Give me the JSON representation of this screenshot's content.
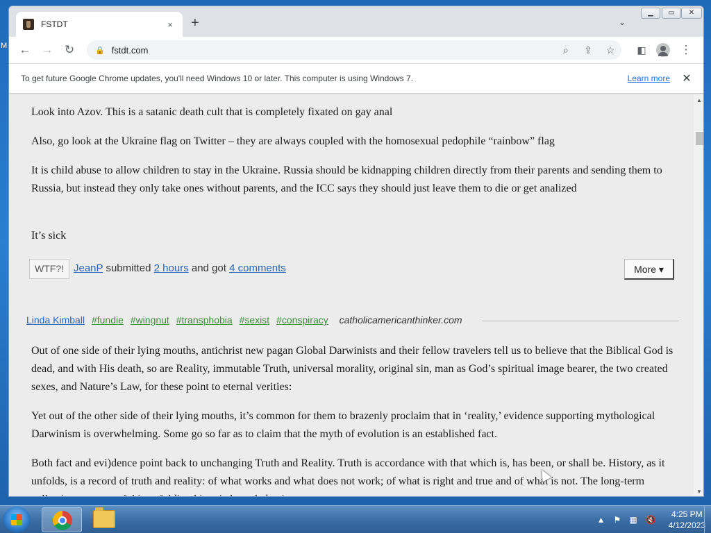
{
  "desktop": {
    "edge_letter": "M"
  },
  "browser": {
    "tab_title": "FSTDT",
    "tab_close": "×",
    "new_tab": "+",
    "tab_search": "⌄",
    "url": "fstdt.com",
    "infobar": {
      "text": "To get future Google Chrome updates, you'll need Windows 10 or later. This computer is using Windows 7.",
      "link": "Learn more",
      "close": "✕"
    }
  },
  "post1": {
    "paragraphs": [
      "Look into Azov. This is a satanic death cult that is completely fixated on gay anal",
      "Also, go look at the Ukraine flag on Twitter – they are always coupled with the homosexual pedophile “rainbow” flag",
      "It is child abuse to allow children to stay in the Ukraine. Russia should be kidnapping children directly from their parents and sending them to Russia, but instead they only take ones without parents, and the ICC says they should just leave them to die or get analized",
      "It’s sick"
    ],
    "footer": {
      "wtf": "WTF?!",
      "author": "JeanP",
      "submitted": "submitted",
      "time": "2 hours",
      "and_got": "and got",
      "comments": "4 comments",
      "more": "More ▾"
    }
  },
  "post2": {
    "author": "Linda Kimball",
    "tags": [
      "#fundie",
      "#wingnut",
      "#transphobia",
      "#sexist",
      "#conspiracy"
    ],
    "source": "catholicamericanthinker.com",
    "paragraphs": [
      "Out of one side of their lying mouths, antichrist new pagan Global Darwinists and their fellow travelers tell us to believe that the Biblical God is dead, and with His death, so are Reality, immutable Truth, universal morality, original sin, man as God’s spiritual image bearer, the two created sexes, and Nature’s Law, for these point to eternal verities:",
      "Yet out of the other side of their lying mouths, it’s common for them to brazenly proclaim that in ‘reality,’ evidence supporting mythological Darwinism is overwhelming. Some go so far as to claim that the myth of evolution is an established fact.",
      "Both fact and evi)dence point back to unchanging Truth and Reality. Truth is accordance with that which is, has been, or shall be. History, as it unfolds, is a record of truth and reality: of what works and what does not work; of what is right and true and of what is not. The long-term collective memory of this unfolding historic knowledge is common sense."
    ]
  },
  "taskbar": {
    "time": "4:25 PM",
    "date": "4/12/2023"
  }
}
